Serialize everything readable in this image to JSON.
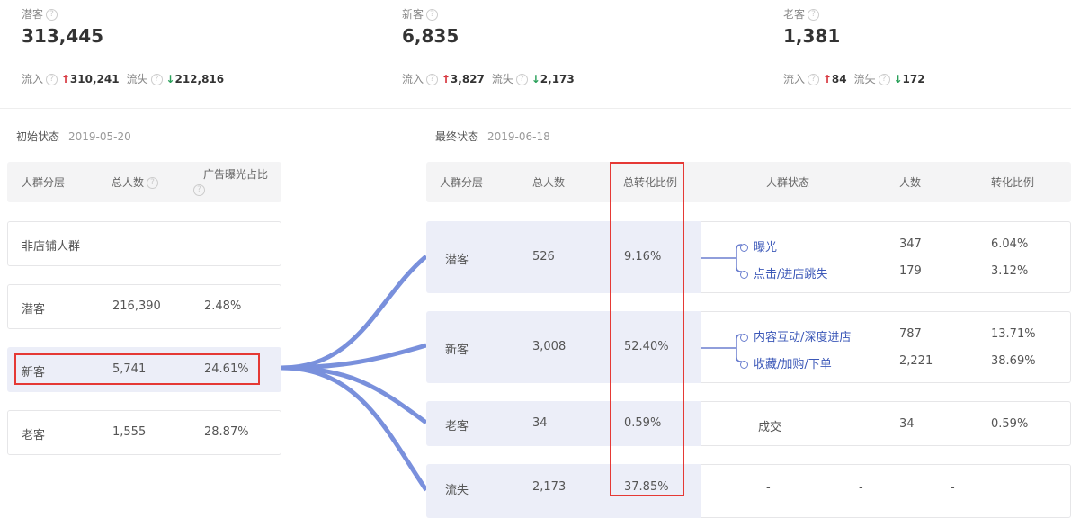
{
  "stats": [
    {
      "label": "潜客",
      "value": "313,445",
      "in_label": "流入",
      "in_value": "310,241",
      "out_label": "流失",
      "out_value": "212,816"
    },
    {
      "label": "新客",
      "value": "6,835",
      "in_label": "流入",
      "in_value": "3,827",
      "out_label": "流失",
      "out_value": "2,173"
    },
    {
      "label": "老客",
      "value": "1,381",
      "in_label": "流入",
      "in_value": "84",
      "out_label": "流失",
      "out_value": "172"
    }
  ],
  "initial": {
    "title": "初始状态",
    "date": "2019-05-20",
    "headers": [
      "人群分层",
      "总人数",
      "广告曝光占比"
    ],
    "rows": [
      {
        "name": "非店铺人群",
        "count": "",
        "ratio": ""
      },
      {
        "name": "潜客",
        "count": "216,390",
        "ratio": "2.48%"
      },
      {
        "name": "新客",
        "count": "5,741",
        "ratio": "24.61%"
      },
      {
        "name": "老客",
        "count": "1,555",
        "ratio": "28.87%"
      }
    ]
  },
  "final": {
    "title": "最终状态",
    "date": "2019-06-18",
    "headers": [
      "人群分层",
      "总人数",
      "总转化比例",
      "人群状态",
      "人数",
      "转化比例"
    ],
    "rows": [
      {
        "name": "潜客",
        "count": "526",
        "ratio": "9.16%",
        "sub": [
          {
            "state": "曝光",
            "count": "347",
            "ratio": "6.04%"
          },
          {
            "state": "点击/进店跳失",
            "count": "179",
            "ratio": "3.12%"
          }
        ]
      },
      {
        "name": "新客",
        "count": "3,008",
        "ratio": "52.40%",
        "sub": [
          {
            "state": "内容互动/深度进店",
            "count": "787",
            "ratio": "13.71%"
          },
          {
            "state": "收藏/加购/下单",
            "count": "2,221",
            "ratio": "38.69%"
          }
        ]
      },
      {
        "name": "老客",
        "count": "34",
        "ratio": "0.59%",
        "sub": [
          {
            "state": "成交",
            "count": "34",
            "ratio": "0.59%"
          }
        ]
      },
      {
        "name": "流失",
        "count": "2,173",
        "ratio": "37.85%",
        "sub": [
          {
            "state": "-",
            "count": "-",
            "ratio": "-"
          }
        ]
      }
    ]
  },
  "help_icon": "?",
  "colors": {
    "accent": "#3c58b8",
    "flow": "#6b84d9",
    "highlight": "#e53935",
    "up": "#d0121b",
    "down": "#2aa05a"
  }
}
